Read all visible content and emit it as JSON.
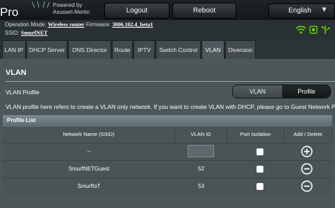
{
  "header": {
    "brand_suffix": "Pro",
    "powered_line1": "Powered by",
    "powered_line2": "Asuswrt-Merlin",
    "logout_label": "Logout",
    "reboot_label": "Reboot",
    "language": "English"
  },
  "info": {
    "op_mode_label": "Operation Mode:",
    "op_mode_value": "Wireless router",
    "firmware_label": "Firmware:",
    "firmware_value": "3006.102.4_beta1",
    "ssid_label": "SSID:",
    "ssid_value": "SmurfNET"
  },
  "tabs": [
    {
      "label": "LAN IP"
    },
    {
      "label": "DHCP Server"
    },
    {
      "label": "DNS Director"
    },
    {
      "label": "Route"
    },
    {
      "label": "IPTV"
    },
    {
      "label": "Switch Control"
    },
    {
      "label": "VLAN"
    },
    {
      "label": "Diversion"
    }
  ],
  "active_tab": "VLAN",
  "page": {
    "title": "VLAN",
    "profile_label": "VLAN Profile",
    "segment_vlan": "VLAN",
    "segment_profile": "Profile",
    "segment_selected": "Profile",
    "note": "VLAN profile here refers to create a VLAN only network. If you want to create VLAN with DHCP, please go to Guest Network Pro"
  },
  "profile_list": {
    "title": "Profile List",
    "columns": [
      "Network Name (SSID)",
      "VLAN ID",
      "Port Isolation",
      "Add / Delete"
    ],
    "rows": [
      {
        "ssid": "--",
        "vlan_id": "",
        "port_isolation": false,
        "action": "add"
      },
      {
        "ssid": "SmurfNETGuest",
        "vlan_id": "52",
        "port_isolation": false,
        "action": "delete"
      },
      {
        "ssid": "SmurfIoT",
        "vlan_id": "53",
        "port_isolation": false,
        "action": "delete"
      }
    ]
  },
  "colors": {
    "accent_green": "#5fd400",
    "panel_bg": "#4d5659",
    "table_header": "#6d7d83"
  }
}
